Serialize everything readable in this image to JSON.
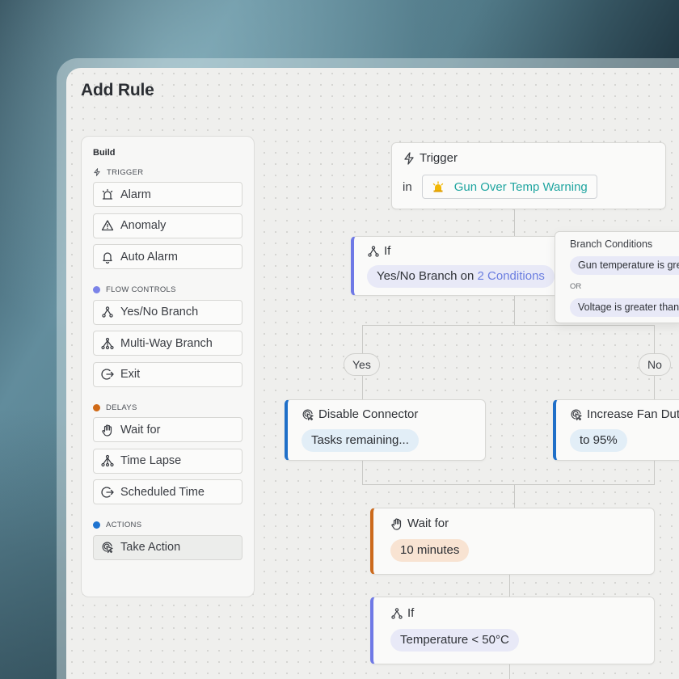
{
  "page": {
    "title": "Add Rule"
  },
  "sidebar": {
    "heading": "Build",
    "sections": {
      "trigger": {
        "label": "TRIGGER",
        "items": [
          "Alarm",
          "Anomaly",
          "Auto Alarm"
        ]
      },
      "flow": {
        "label": "FLOW CONTROLS",
        "color": "#7b83e8",
        "items": [
          "Yes/No Branch",
          "Multi-Way Branch",
          "Exit"
        ]
      },
      "delays": {
        "label": "DELAYS",
        "color": "#d06a17",
        "items": [
          "Wait for",
          "Time Lapse",
          "Scheduled Time"
        ]
      },
      "actions": {
        "label": "ACTIONS",
        "color": "#1f74d0",
        "items": [
          "Take Action"
        ]
      }
    }
  },
  "flow": {
    "trigger": {
      "title": "Trigger",
      "prefix": "in",
      "value": "Gun Over Temp Warning"
    },
    "if1": {
      "title": "If",
      "text": "Yes/No Branch on ",
      "link": "2 Conditions"
    },
    "popover": {
      "title": "Branch Conditions",
      "cond1": "Gun temperature is greater",
      "or": "OR",
      "cond2": "Voltage is greater than"
    },
    "yes_label": "Yes",
    "no_label": "No",
    "disable": {
      "title": "Disable Connector",
      "value": "Tasks remaining..."
    },
    "increase": {
      "title": "Increase Fan Duty",
      "value": "to 95%"
    },
    "wait": {
      "title": "Wait for",
      "value": "10 minutes"
    },
    "if2": {
      "title": "If",
      "value": "Temperature < 50°C"
    }
  },
  "colors": {
    "accent": "#6b7ee0",
    "teal_text": "#1fa5a0",
    "warning_icon": "#f2b705"
  }
}
